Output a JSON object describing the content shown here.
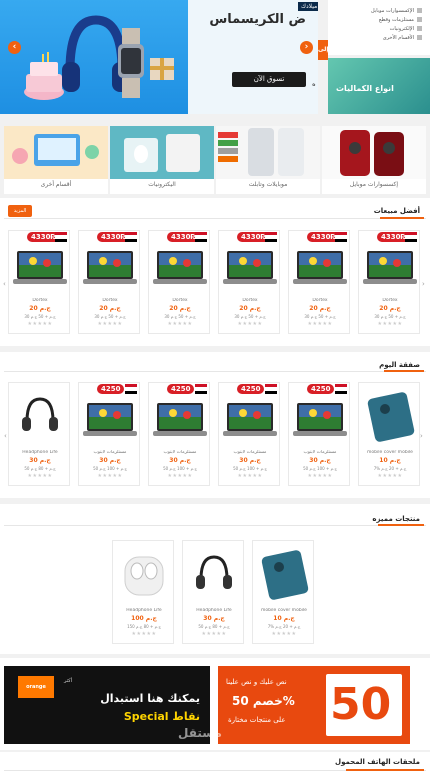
{
  "hero": {
    "promo_tag": "ميلادك",
    "heading": "ض الكريسماس",
    "shop_button": "تسوق الآن",
    "cut_label": "إلى"
  },
  "side": {
    "items": [
      "الإكسسوارات موبايل",
      "مستلزمات وقطع",
      "الإلكترونيات",
      "الأقسام الأخرى"
    ],
    "banner_text": "انواع الكماليات"
  },
  "categories": [
    {
      "label": "إكسسوارات موبايل"
    },
    {
      "label": "موبايلات وتابلت"
    },
    {
      "label": "اليكترونيات"
    },
    {
      "label": "أقسام أخرى"
    }
  ],
  "best_sellers": {
    "title": "أفضل مبيعات",
    "more": "المزيد",
    "products": [
      {
        "badge": "4330₪",
        "name": "Dortex",
        "price": "20 ج.م",
        "old": "30 ج.م + 50 ج.م",
        "stars": "★★★★★"
      },
      {
        "badge": "4330₪",
        "name": "Dortex",
        "price": "20 ج.م",
        "old": "30 ج.م + 50 ج.م",
        "stars": "★★★★★"
      },
      {
        "badge": "4330₪",
        "name": "Dortex",
        "price": "20 ج.م",
        "old": "30 ج.م + 50 ج.م",
        "stars": "★★★★★"
      },
      {
        "badge": "4330₪",
        "name": "Dortex",
        "price": "20 ج.م",
        "old": "30 ج.م + 50 ج.م",
        "stars": "★★★★★"
      },
      {
        "badge": "4330₪",
        "name": "Dortex",
        "price": "20 ج.م",
        "old": "30 ج.م + 50 ج.م",
        "stars": "★★★★★"
      },
      {
        "badge": "4330₪",
        "name": "Dortex",
        "price": "20 ج.م",
        "old": "30 ج.م + 50 ج.م",
        "stars": "★★★★★"
      }
    ]
  },
  "deal_of_day": {
    "title": "صفقة اليوم",
    "products": [
      {
        "kind": "headphone",
        "badge": "",
        "name": "Headphone Life",
        "price": "30 ج.م",
        "old": "50 ج.م + 80 ج.م",
        "stars": "★★★★★"
      },
      {
        "kind": "laptop",
        "badge": "4250",
        "name": "مستلزمات لابتوب",
        "price": "30 ج.م",
        "old": "50 ج.م + 100 ج.م",
        "stars": "★★★★★"
      },
      {
        "kind": "laptop",
        "badge": "4250",
        "name": "مستلزمات لابتوب",
        "price": "30 ج.م",
        "old": "50 ج.م + 100 ج.م",
        "stars": "★★★★★"
      },
      {
        "kind": "laptop",
        "badge": "4250",
        "name": "مستلزمات لابتوب",
        "price": "30 ج.م",
        "old": "50 ج.م + 100 ج.م",
        "stars": "★★★★★"
      },
      {
        "kind": "laptop",
        "badge": "4250",
        "name": "مستلزمات لابتوب",
        "price": "30 ج.م",
        "old": "50 ج.م + 100 ج.م",
        "stars": "★★★★★"
      },
      {
        "kind": "case",
        "badge": "",
        "name": "mobile cover mobile",
        "price": "10 ج.م",
        "old": "7% ج.م + 20 ج.م",
        "stars": "★★★★★"
      }
    ]
  },
  "featured": {
    "title": "منتجات مميزه",
    "products": [
      {
        "kind": "earbuds",
        "name": "Headphone Life",
        "price": "100 ج.م",
        "old": "150 ج.م + 80 ج.م",
        "stars": "★★★★★"
      },
      {
        "kind": "headphone",
        "name": "Headphone Life",
        "price": "30 ج.م",
        "old": "50 ج.م + 80 ج.م",
        "stars": "★★★★★"
      },
      {
        "kind": "case",
        "name": "mobile cover mobile",
        "price": "10 ج.م",
        "old": "7% ج.م + 20 ج.م",
        "stars": "★★★★★"
      }
    ]
  },
  "banners": {
    "left_line1": "يمكنك هنا استبدال",
    "left_line2": "Special نقاط",
    "left_brand": "orange",
    "right_number": "50",
    "right_line1": "نص عليك و نص علينا",
    "right_line2": "خصم 50%",
    "right_line3": "على منتجات مختارة"
  },
  "watermark": "مستقل",
  "last_section": {
    "title": "ملحقات الهاتف المحمول"
  },
  "colors": {
    "accent": "#f0610f",
    "badge": "#d81f26",
    "hero_blue": "#1e8fe2"
  }
}
